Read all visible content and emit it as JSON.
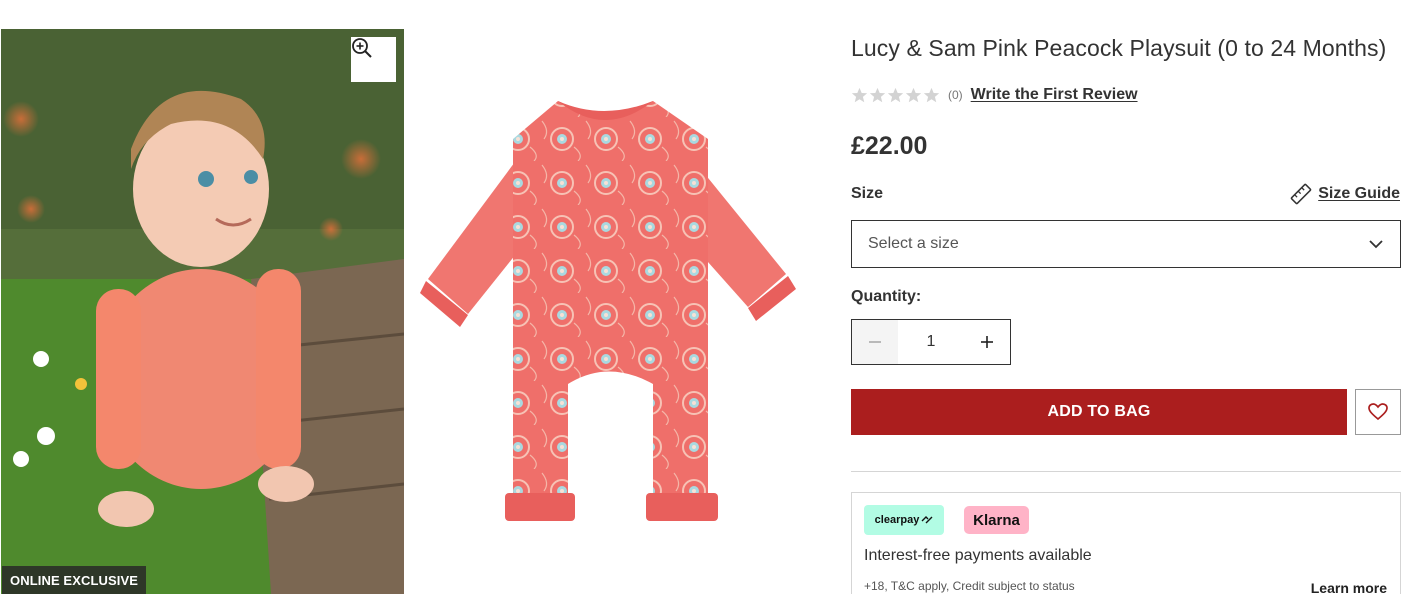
{
  "gallery": {
    "badge": "ONLINE EXCLUSIVE",
    "zoom_icon": "zoom-in-icon"
  },
  "product": {
    "title": "Lucy & Sam Pink Peacock Playsuit (0 to 24 Months)",
    "rating": {
      "stars": 0,
      "max_stars": 5,
      "count": "(0)",
      "review_link": "Write the First Review"
    },
    "price": "£22.00"
  },
  "size": {
    "label": "Size",
    "guide_label": "Size Guide",
    "select_placeholder": "Select a size"
  },
  "quantity": {
    "label": "Quantity:",
    "value": "1"
  },
  "actions": {
    "add_to_bag": "ADD TO BAG",
    "wishlist_icon": "heart-icon"
  },
  "payments": {
    "clearpay": "clearpay",
    "klarna": "Klarna",
    "headline": "Interest-free payments available",
    "terms": "+18, T&C apply, Credit subject to status",
    "learn_more": "Learn more"
  },
  "colors": {
    "accent": "#ab1e1e",
    "clearpay_bg": "#b2fce4",
    "klarna_bg": "#ffb3c7",
    "garment": "#f0706a"
  }
}
